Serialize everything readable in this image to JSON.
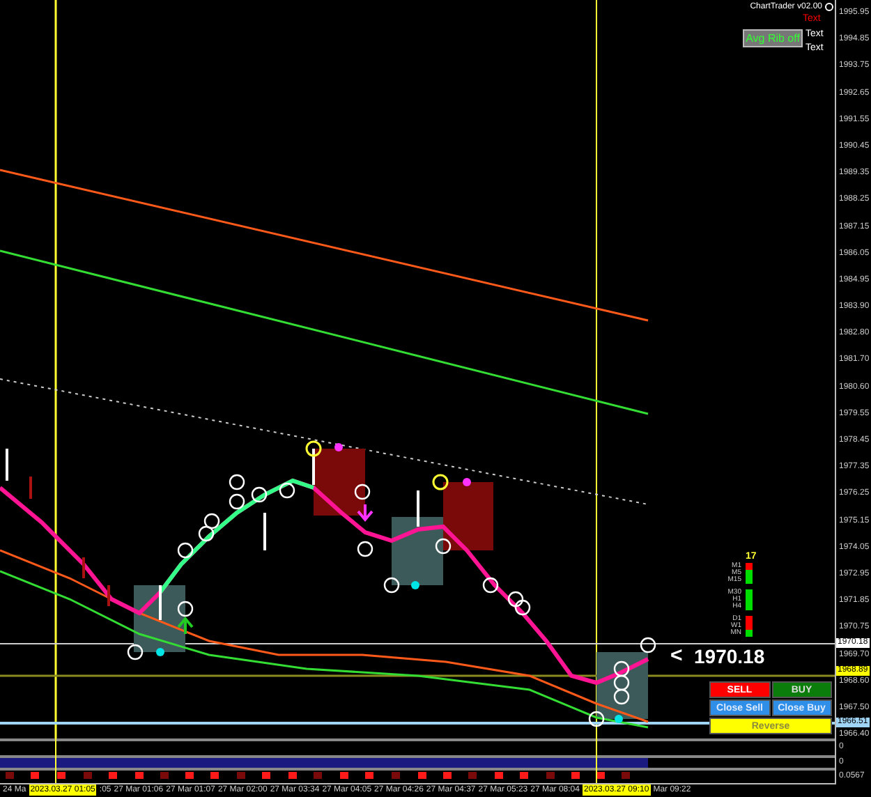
{
  "header": {
    "title": "ChartTrader v02.00",
    "notes": [
      {
        "text": "Text",
        "color": "#ff0000"
      },
      {
        "text": "Text",
        "color": "#ffffff"
      },
      {
        "text": "Text",
        "color": "#ffffff"
      }
    ],
    "toggle": {
      "label": "Avg Rib off"
    }
  },
  "price_axis": {
    "ticks": [
      "1995.95",
      "1994.85",
      "1993.75",
      "1992.65",
      "1991.55",
      "1990.45",
      "1989.35",
      "1988.25",
      "1987.15",
      "1986.05",
      "1984.95",
      "1983.90",
      "1982.80",
      "1981.70",
      "1980.60",
      "1979.55",
      "1978.45",
      "1977.35",
      "1976.25",
      "1975.15",
      "1974.05",
      "1972.95",
      "1971.85",
      "1970.75",
      "1969.70",
      "1968.60",
      "1967.50",
      "1966.40"
    ],
    "markers": [
      {
        "text": "1970.18",
        "color": "#ffffff"
      },
      {
        "text": "1968.89",
        "color": "#ffff00"
      },
      {
        "text": "1966.51",
        "color": "#9fd4f5"
      }
    ]
  },
  "signals": {
    "count": "17",
    "rows": [
      {
        "label": "M1",
        "color": "#ff0000"
      },
      {
        "label": "M5",
        "color": "#00dd00"
      },
      {
        "label": "M15",
        "color": "#00dd00"
      },
      {
        "label": "M30",
        "color": "#00dd00"
      },
      {
        "label": "H1",
        "color": "#00dd00"
      },
      {
        "label": "H4",
        "color": "#00dd00"
      },
      {
        "label": "D1",
        "color": "#ff0000"
      },
      {
        "label": "W1",
        "color": "#ff0000"
      },
      {
        "label": "MN",
        "color": "#00dd00"
      }
    ]
  },
  "price_label": {
    "arrow": "<",
    "value": "1970.18"
  },
  "buttons": [
    {
      "label": "SELL",
      "kind": "sell"
    },
    {
      "label": "BUY",
      "kind": "buy"
    },
    {
      "label": "Close Sell",
      "kind": "close"
    },
    {
      "label": "Close Buy",
      "kind": "close"
    },
    {
      "label": "Reverse",
      "kind": "reverse"
    }
  ],
  "subpanels": {
    "labels": [
      "0",
      "0",
      "0.0567"
    ]
  },
  "time_axis": {
    "labels": [
      {
        "text": "24 Ma",
        "kind": "plain"
      },
      {
        "text": "2023.03.27 01:05",
        "kind": "cursor"
      },
      {
        "text": ":05",
        "kind": "plain"
      },
      {
        "text": "27 Mar 01:06",
        "kind": "plain"
      },
      {
        "text": "27 Mar 01:07",
        "kind": "plain"
      },
      {
        "text": "27 Mar 02:00",
        "kind": "plain"
      },
      {
        "text": "27 Mar 03:34",
        "kind": "plain"
      },
      {
        "text": "27 Mar 04:05",
        "kind": "plain"
      },
      {
        "text": "27 Mar 04:26",
        "kind": "plain"
      },
      {
        "text": "27 Mar 04:37",
        "kind": "plain"
      },
      {
        "text": "27 Mar 05:23",
        "kind": "plain"
      },
      {
        "text": "27 Mar 08:04",
        "kind": "plain"
      },
      {
        "text": "2023.03.27 09:10",
        "kind": "cursor"
      },
      {
        "text": "Mar 09:22",
        "kind": "plain"
      }
    ]
  }
}
